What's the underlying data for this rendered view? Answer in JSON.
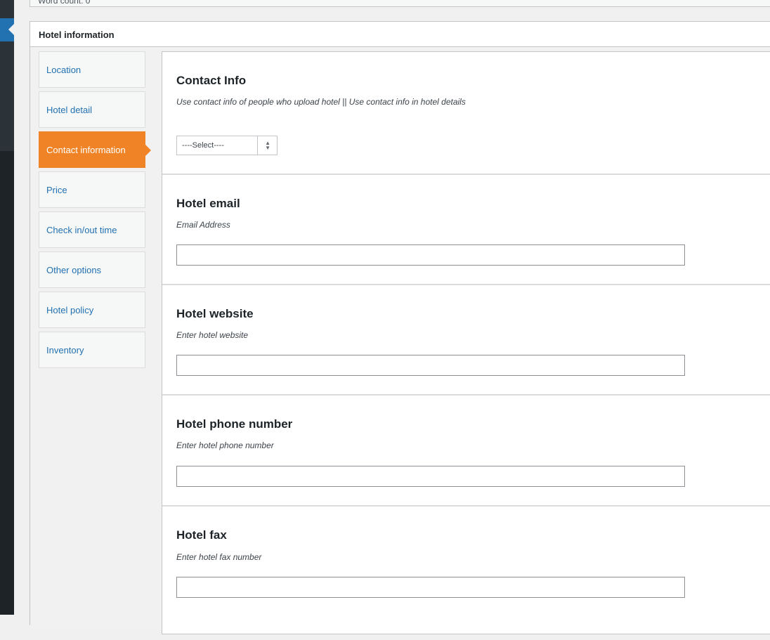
{
  "word_count": "Word count: 0",
  "metabox": {
    "title": "Hotel information"
  },
  "tabs": [
    {
      "label": "Location",
      "active": false
    },
    {
      "label": "Hotel detail",
      "active": false
    },
    {
      "label": "Contact information",
      "active": true
    },
    {
      "label": "Price",
      "active": false
    },
    {
      "label": "Check in/out time",
      "active": false
    },
    {
      "label": "Other options",
      "active": false
    },
    {
      "label": "Hotel policy",
      "active": false
    },
    {
      "label": "Inventory",
      "active": false
    }
  ],
  "sections": {
    "contact_info": {
      "title": "Contact Info",
      "description": "Use contact info of people who upload hotel || Use contact info in hotel details",
      "select_value": "----Select----"
    },
    "email": {
      "title": "Hotel email",
      "description": "Email Address",
      "value": ""
    },
    "website": {
      "title": "Hotel website",
      "description": "Enter hotel website",
      "value": ""
    },
    "phone": {
      "title": "Hotel phone number",
      "description": "Enter hotel phone number",
      "value": ""
    },
    "fax": {
      "title": "Hotel fax",
      "description": "Enter hotel fax number",
      "value": ""
    }
  },
  "colors": {
    "accent": "#ef8326",
    "link": "#2271b1",
    "admin_bar": "#1d2327"
  }
}
